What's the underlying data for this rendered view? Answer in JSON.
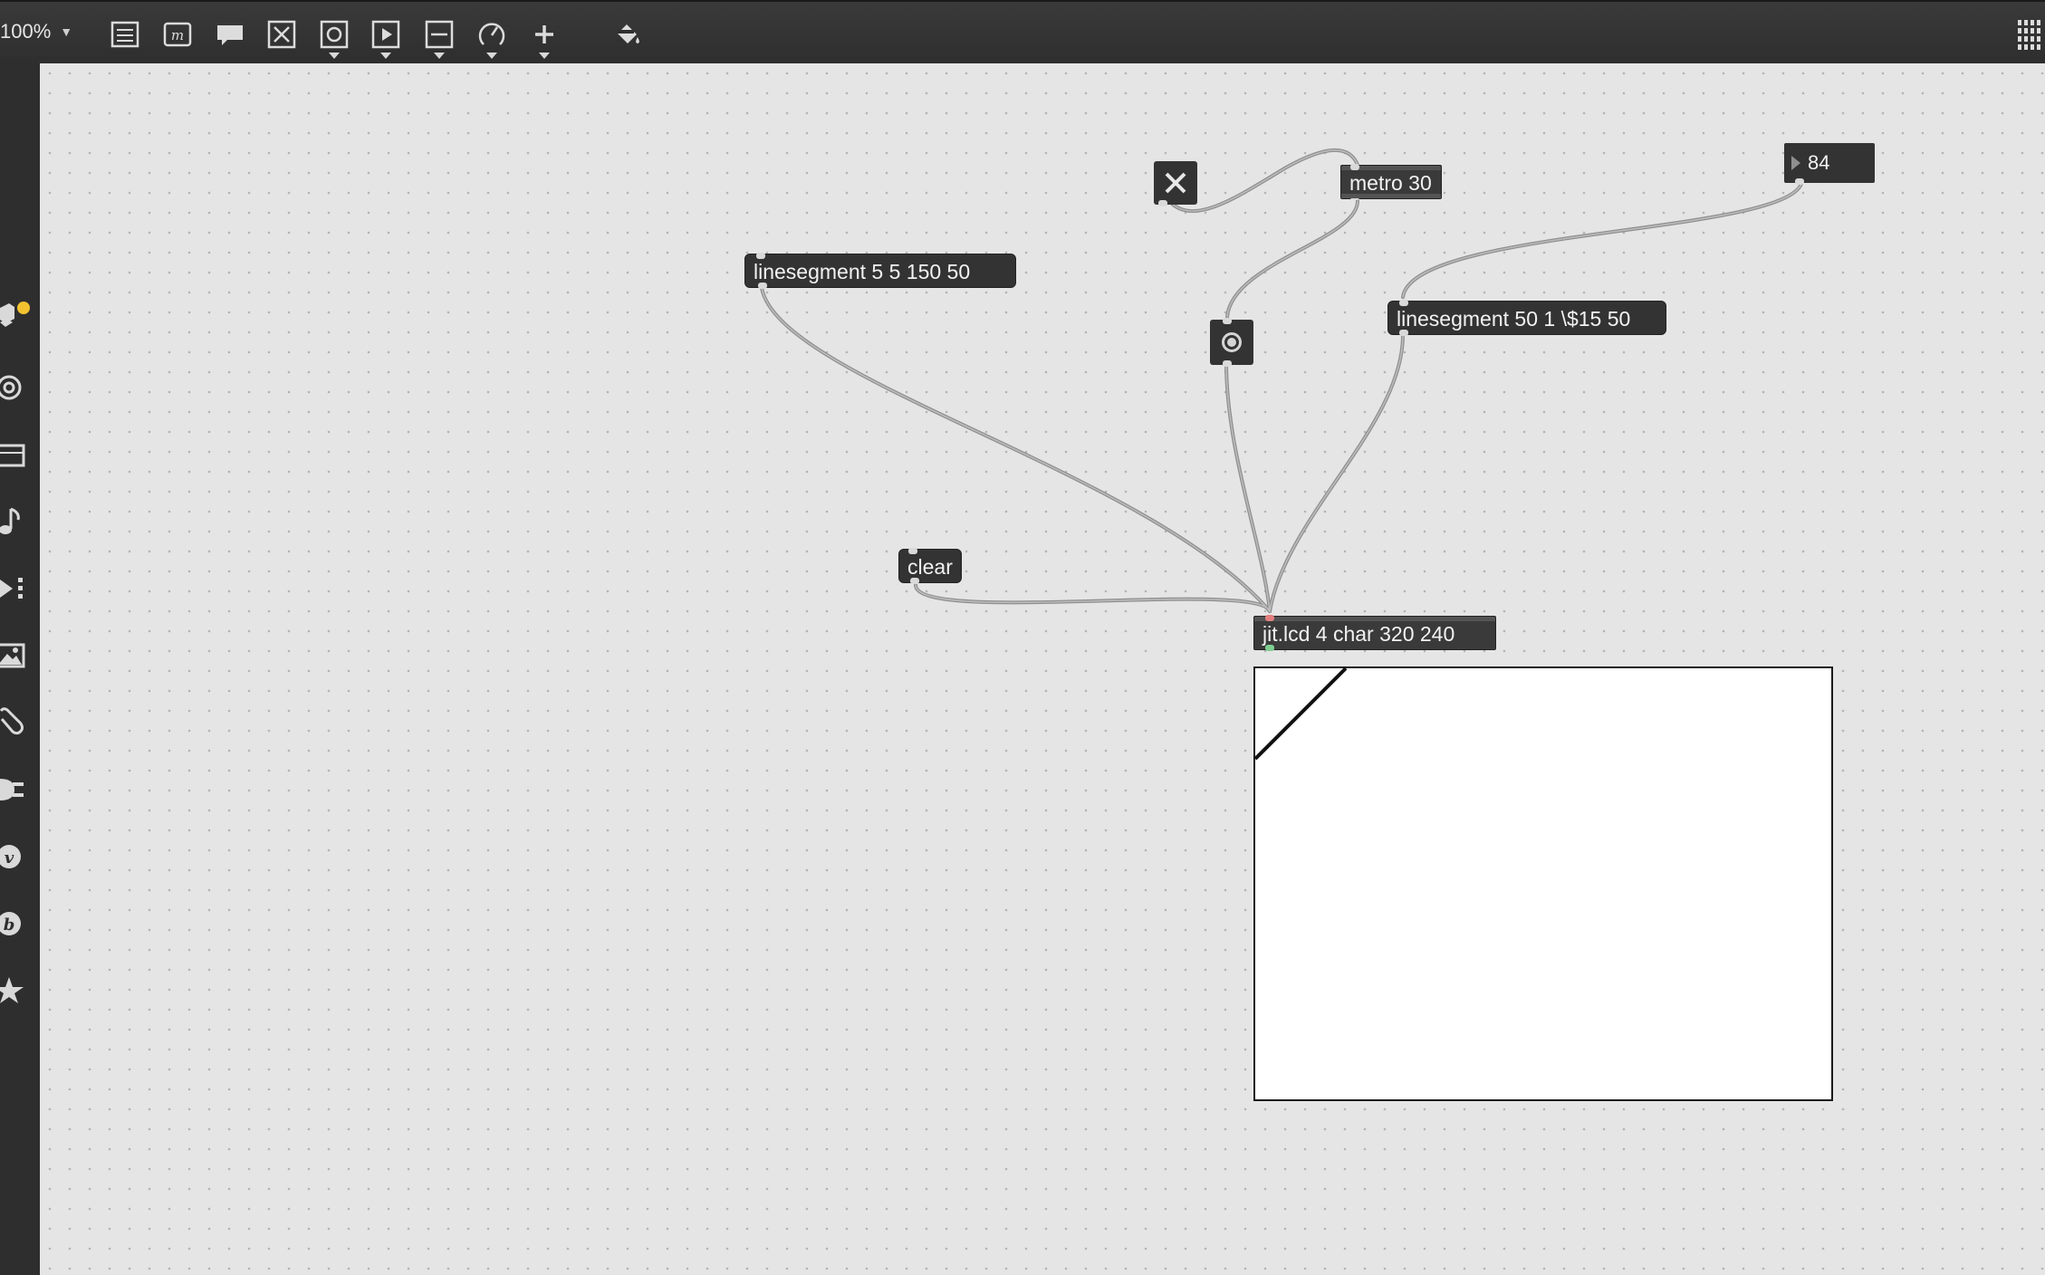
{
  "toolbar": {
    "zoom_label": "100%",
    "tools": [
      "presentation-mode-icon",
      "message-box-icon",
      "comment-icon",
      "toggle-object-icon",
      "bang-object-icon",
      "play-object-icon",
      "slider-object-icon",
      "dial-object-icon",
      "add-object-icon",
      "paint-bucket-icon"
    ],
    "right_icon": "grid-menu-icon"
  },
  "sidebar": {
    "items": [
      "packages-icon",
      "circle-icon",
      "keyboard-icon",
      "music-note-icon",
      "playlist-icon",
      "image-icon",
      "paperclip-icon",
      "plug-icon",
      "vizzie-icon",
      "beap-icon",
      "star-icon"
    ],
    "badge_color": "#f2c230"
  },
  "patch": {
    "metro": "metro 30",
    "linesegment_1": "linesegment 5 5 150 50",
    "linesegment_2": "linesegment 50 1 \\$15 50",
    "number_value": "84",
    "clear_msg": "clear",
    "jit_lcd": "jit.lcd 4 char 320 240"
  },
  "colors": {
    "object_bg": "#333333",
    "canvas_bg": "#e5e5e5",
    "patch_cord": "#9a9a9a",
    "lcd_bg": "#ffffff"
  }
}
